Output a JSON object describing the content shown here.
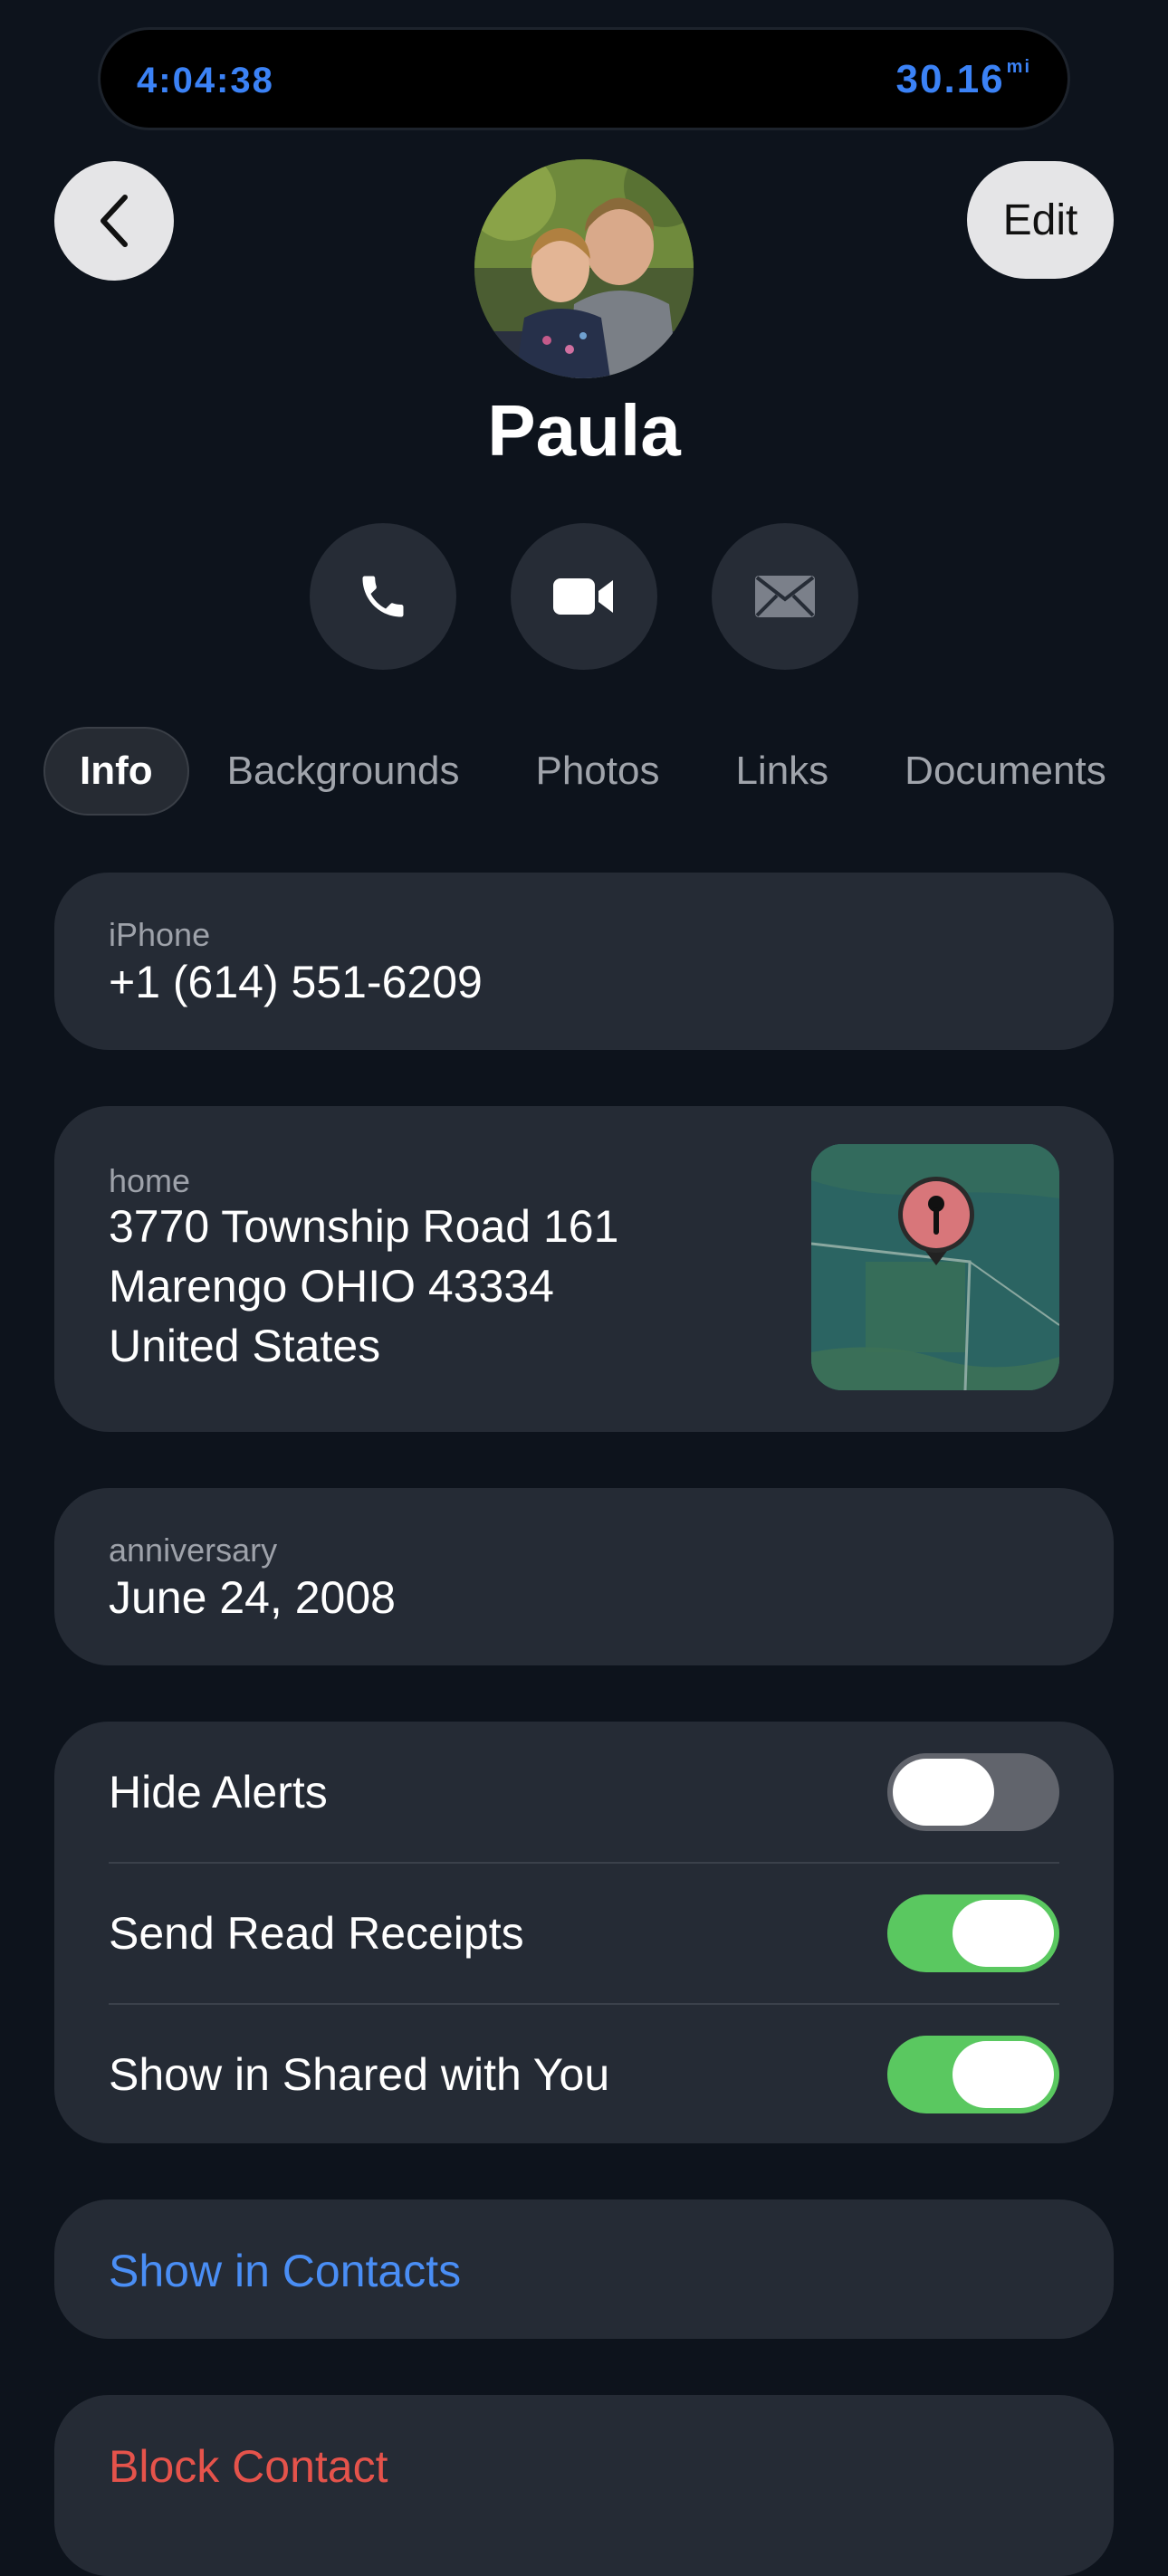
{
  "status": {
    "time": "4:04:38",
    "distance": "30.16",
    "distance_unit": "mi"
  },
  "nav": {
    "edit_label": "Edit"
  },
  "contact": {
    "name": "Paula"
  },
  "tabs": [
    "Info",
    "Backgrounds",
    "Photos",
    "Links",
    "Documents"
  ],
  "phone": {
    "label": "iPhone",
    "value": "+1 (614) 551-6209"
  },
  "address": {
    "label": "home",
    "line1": "3770 Township Road 161",
    "line2": "Marengo OHIO 43334",
    "line3": "United States"
  },
  "anniversary": {
    "label": "anniversary",
    "value": "June 24, 2008"
  },
  "settings": [
    {
      "label": "Hide Alerts",
      "on": false
    },
    {
      "label": "Send Read Receipts",
      "on": true
    },
    {
      "label": "Show in Shared with You",
      "on": true
    }
  ],
  "links": {
    "show_in_contacts": "Show in Contacts",
    "block_contact": "Block Contact"
  },
  "colors": {
    "background": "#0d131c",
    "card": "#252b35",
    "accent_blue": "#4a8ef5",
    "destructive_red": "#e5534b",
    "toggle_on": "#5ac860",
    "toggle_off": "#61646c"
  },
  "icons": {
    "back": "chevron-left-icon",
    "call": "phone-icon",
    "video": "video-camera-icon",
    "mail": "envelope-icon",
    "map_pin": "map-pin-icon"
  }
}
